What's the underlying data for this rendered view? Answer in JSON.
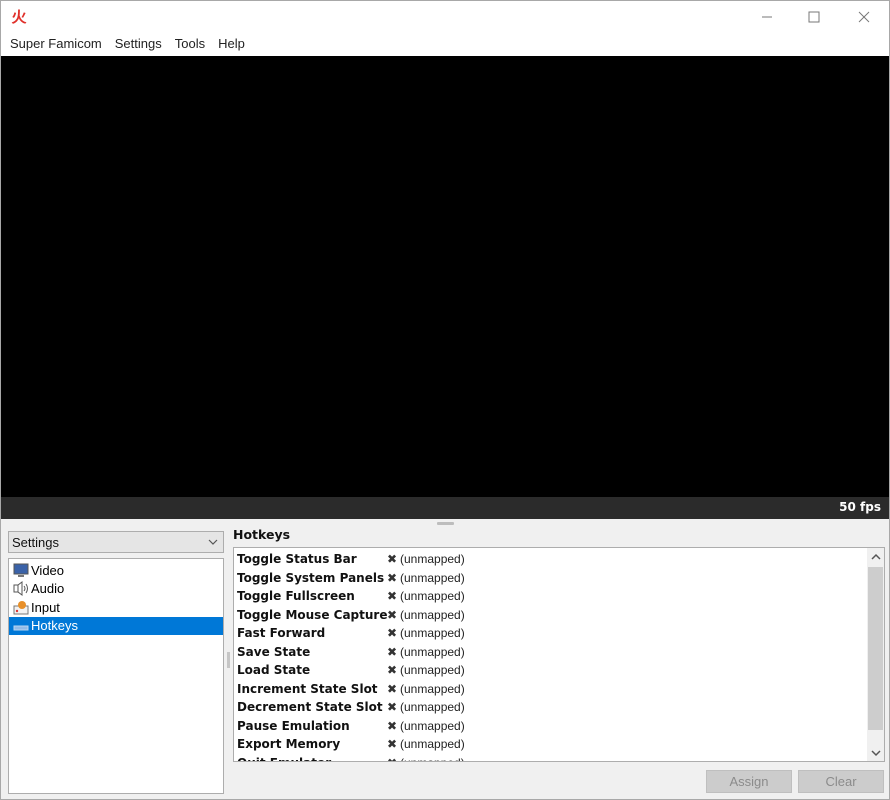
{
  "window": {
    "app_icon_glyph": "火",
    "controls": {
      "minimize": "—",
      "maximize": "☐",
      "close": "✕"
    }
  },
  "menubar": {
    "items": [
      "Super Famicom",
      "Settings",
      "Tools",
      "Help"
    ]
  },
  "statusbar": {
    "fps": "50 fps"
  },
  "settings_panel": {
    "combo_value": "Settings",
    "tree": [
      {
        "label": "Video",
        "icon": "monitor-icon",
        "selected": false
      },
      {
        "label": "Audio",
        "icon": "speaker-icon",
        "selected": false
      },
      {
        "label": "Input",
        "icon": "gamepad-icon",
        "selected": false
      },
      {
        "label": "Hotkeys",
        "icon": "keyboard-icon",
        "selected": true
      }
    ]
  },
  "hotkeys": {
    "title": "Hotkeys",
    "rows": [
      {
        "name": "Toggle Status Bar",
        "value": "(unmapped)"
      },
      {
        "name": "Toggle System Panels",
        "value": "(unmapped)"
      },
      {
        "name": "Toggle Fullscreen",
        "value": "(unmapped)"
      },
      {
        "name": "Toggle Mouse Capture",
        "value": "(unmapped)"
      },
      {
        "name": "Fast Forward",
        "value": "(unmapped)"
      },
      {
        "name": "Save State",
        "value": "(unmapped)"
      },
      {
        "name": "Load State",
        "value": "(unmapped)"
      },
      {
        "name": "Increment State Slot",
        "value": "(unmapped)"
      },
      {
        "name": "Decrement State Slot",
        "value": "(unmapped)"
      },
      {
        "name": "Pause Emulation",
        "value": "(unmapped)"
      },
      {
        "name": "Export Memory",
        "value": "(unmapped)"
      },
      {
        "name": "Quit Emulator",
        "value": "(unmapped)"
      }
    ],
    "unmapped_glyph": "✖",
    "assign_label": "Assign",
    "clear_label": "Clear"
  },
  "colors": {
    "selection": "#0078d7",
    "status_bar": "#2b2b2b",
    "viewport": "#000000"
  }
}
